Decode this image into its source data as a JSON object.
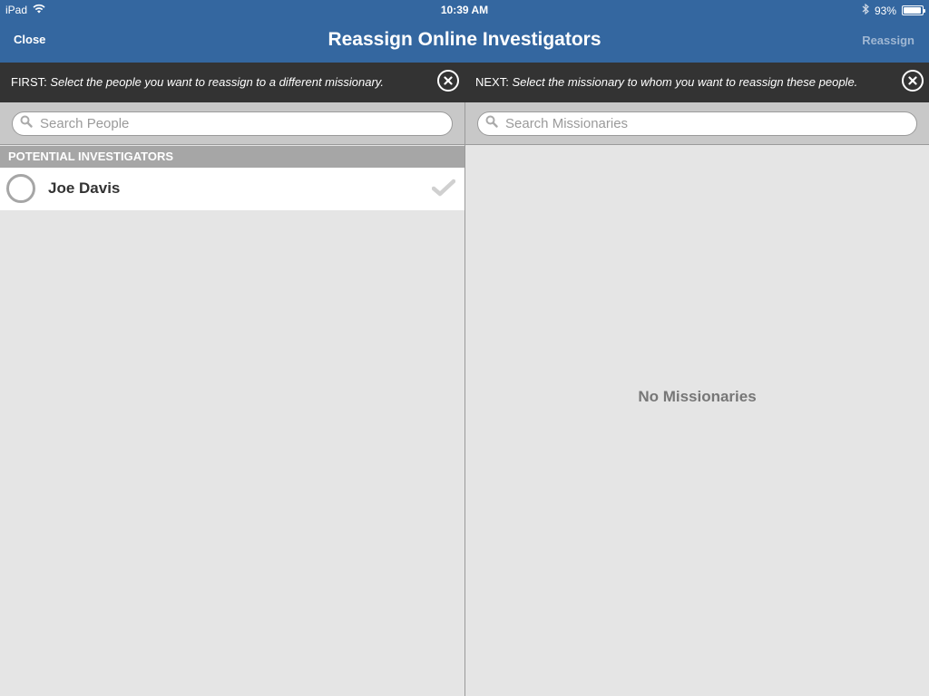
{
  "status_bar": {
    "device": "iPad",
    "time": "10:39 AM",
    "battery": "93%",
    "battery_level": 0.93,
    "icons": [
      "wifi-icon",
      "bluetooth-icon",
      "battery-icon"
    ]
  },
  "nav": {
    "close_label": "Close",
    "title": "Reassign Online Investigators",
    "reassign_label": "Reassign"
  },
  "instructions": {
    "left_lead": "FIRST:",
    "left_text": "Select the people you want to reassign to a different missionary.",
    "right_lead": "NEXT:",
    "right_text": "Select the missionary to whom you want to reassign these people."
  },
  "search": {
    "people_placeholder": "Search People",
    "missionaries_placeholder": "Search Missionaries"
  },
  "people": {
    "section_title": "POTENTIAL INVESTIGATORS",
    "items": [
      {
        "name": "Joe Davis"
      }
    ]
  },
  "missionaries": {
    "empty_text": "No Missionaries"
  },
  "colors": {
    "nav_bg": "#3467a0",
    "instruction_bg": "#333333",
    "section_header_bg": "#a6a6a6",
    "content_bg": "#e5e5e5"
  }
}
